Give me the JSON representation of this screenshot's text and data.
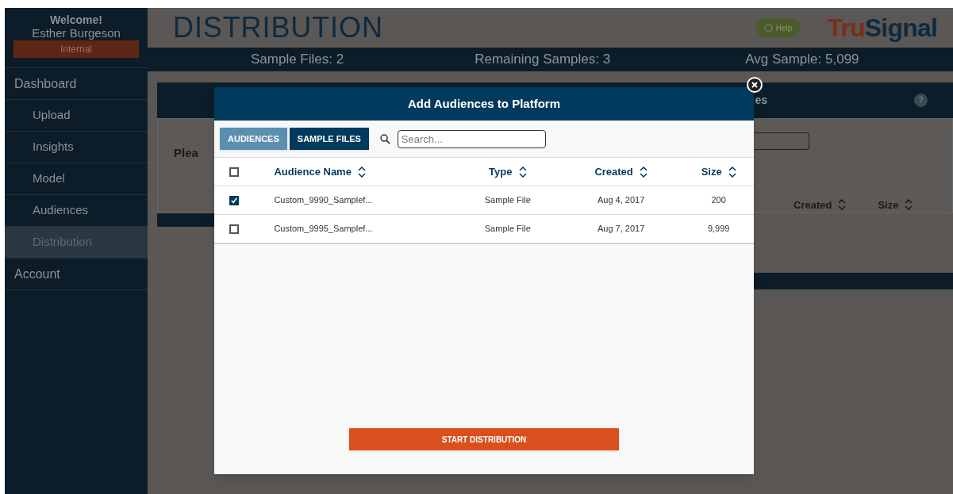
{
  "sidebar": {
    "welcome": "Welcome!",
    "user": "Esther Burgeson",
    "role": "Internal",
    "items": [
      {
        "label": "Dashboard",
        "selected": false,
        "children": [
          {
            "label": "Upload",
            "selected": false
          },
          {
            "label": "Insights",
            "selected": false
          },
          {
            "label": "Model",
            "selected": false
          },
          {
            "label": "Audiences",
            "selected": false
          },
          {
            "label": "Distribution",
            "selected": true
          }
        ]
      },
      {
        "label": "Account",
        "selected": false
      }
    ]
  },
  "header": {
    "title": "DISTRIBUTION",
    "help": "Help",
    "logo": {
      "part_1": "Tru",
      "part_2": "Signal"
    }
  },
  "stats": [
    "Sample Files: 2",
    "Remaining Samples: 3",
    "Avg Sample: 5,099"
  ],
  "background_panel": {
    "title_fragment": "es",
    "help_mark": "?",
    "prompt_fragment": "Plea",
    "columns": [
      "Created",
      "Size"
    ]
  },
  "modal": {
    "title": "Add Audiences to Platform",
    "tabs": [
      {
        "label": "AUDIENCES",
        "selected": false
      },
      {
        "label": "SAMPLE FILES",
        "selected": true
      }
    ],
    "search": {
      "placeholder": "Search..."
    },
    "table": {
      "select_all": false,
      "columns": [
        "Audience Name",
        "Type",
        "Created",
        "Size"
      ],
      "rows": [
        {
          "checked": true,
          "cells": [
            "Custom_9990_Samplef...",
            "Sample File",
            "Aug 4, 2017",
            "200"
          ]
        },
        {
          "checked": false,
          "cells": [
            "Custom_9995_Samplef...",
            "Sample File",
            "Aug 7, 2017",
            "9,999"
          ]
        }
      ]
    },
    "button": "START DISTRIBUTION"
  }
}
